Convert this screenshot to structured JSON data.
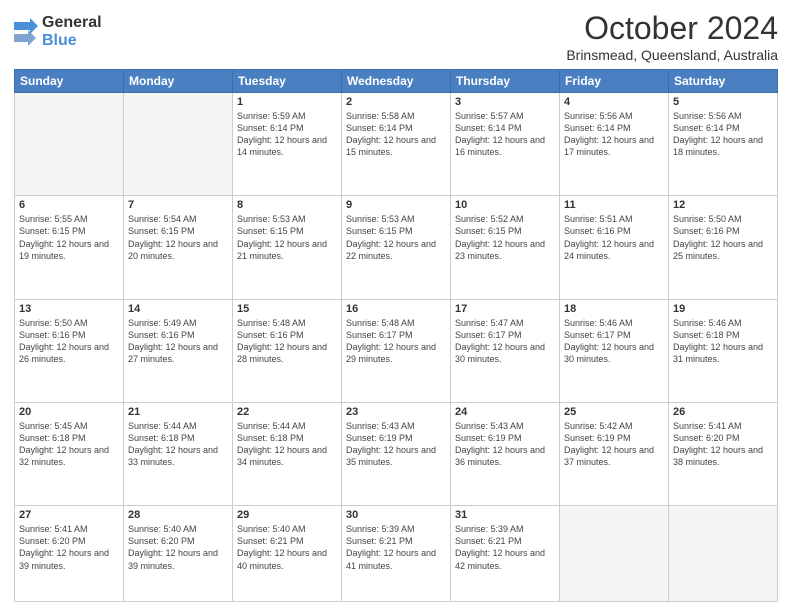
{
  "logo": {
    "general": "General",
    "blue": "Blue"
  },
  "header": {
    "month": "October 2024",
    "location": "Brinsmead, Queensland, Australia"
  },
  "weekdays": [
    "Sunday",
    "Monday",
    "Tuesday",
    "Wednesday",
    "Thursday",
    "Friday",
    "Saturday"
  ],
  "weeks": [
    [
      {
        "day": "",
        "info": ""
      },
      {
        "day": "",
        "info": ""
      },
      {
        "day": "1",
        "info": "Sunrise: 5:59 AM\nSunset: 6:14 PM\nDaylight: 12 hours and 14 minutes."
      },
      {
        "day": "2",
        "info": "Sunrise: 5:58 AM\nSunset: 6:14 PM\nDaylight: 12 hours and 15 minutes."
      },
      {
        "day": "3",
        "info": "Sunrise: 5:57 AM\nSunset: 6:14 PM\nDaylight: 12 hours and 16 minutes."
      },
      {
        "day": "4",
        "info": "Sunrise: 5:56 AM\nSunset: 6:14 PM\nDaylight: 12 hours and 17 minutes."
      },
      {
        "day": "5",
        "info": "Sunrise: 5:56 AM\nSunset: 6:14 PM\nDaylight: 12 hours and 18 minutes."
      }
    ],
    [
      {
        "day": "6",
        "info": "Sunrise: 5:55 AM\nSunset: 6:15 PM\nDaylight: 12 hours and 19 minutes."
      },
      {
        "day": "7",
        "info": "Sunrise: 5:54 AM\nSunset: 6:15 PM\nDaylight: 12 hours and 20 minutes."
      },
      {
        "day": "8",
        "info": "Sunrise: 5:53 AM\nSunset: 6:15 PM\nDaylight: 12 hours and 21 minutes."
      },
      {
        "day": "9",
        "info": "Sunrise: 5:53 AM\nSunset: 6:15 PM\nDaylight: 12 hours and 22 minutes."
      },
      {
        "day": "10",
        "info": "Sunrise: 5:52 AM\nSunset: 6:15 PM\nDaylight: 12 hours and 23 minutes."
      },
      {
        "day": "11",
        "info": "Sunrise: 5:51 AM\nSunset: 6:16 PM\nDaylight: 12 hours and 24 minutes."
      },
      {
        "day": "12",
        "info": "Sunrise: 5:50 AM\nSunset: 6:16 PM\nDaylight: 12 hours and 25 minutes."
      }
    ],
    [
      {
        "day": "13",
        "info": "Sunrise: 5:50 AM\nSunset: 6:16 PM\nDaylight: 12 hours and 26 minutes."
      },
      {
        "day": "14",
        "info": "Sunrise: 5:49 AM\nSunset: 6:16 PM\nDaylight: 12 hours and 27 minutes."
      },
      {
        "day": "15",
        "info": "Sunrise: 5:48 AM\nSunset: 6:16 PM\nDaylight: 12 hours and 28 minutes."
      },
      {
        "day": "16",
        "info": "Sunrise: 5:48 AM\nSunset: 6:17 PM\nDaylight: 12 hours and 29 minutes."
      },
      {
        "day": "17",
        "info": "Sunrise: 5:47 AM\nSunset: 6:17 PM\nDaylight: 12 hours and 30 minutes."
      },
      {
        "day": "18",
        "info": "Sunrise: 5:46 AM\nSunset: 6:17 PM\nDaylight: 12 hours and 30 minutes."
      },
      {
        "day": "19",
        "info": "Sunrise: 5:46 AM\nSunset: 6:18 PM\nDaylight: 12 hours and 31 minutes."
      }
    ],
    [
      {
        "day": "20",
        "info": "Sunrise: 5:45 AM\nSunset: 6:18 PM\nDaylight: 12 hours and 32 minutes."
      },
      {
        "day": "21",
        "info": "Sunrise: 5:44 AM\nSunset: 6:18 PM\nDaylight: 12 hours and 33 minutes."
      },
      {
        "day": "22",
        "info": "Sunrise: 5:44 AM\nSunset: 6:18 PM\nDaylight: 12 hours and 34 minutes."
      },
      {
        "day": "23",
        "info": "Sunrise: 5:43 AM\nSunset: 6:19 PM\nDaylight: 12 hours and 35 minutes."
      },
      {
        "day": "24",
        "info": "Sunrise: 5:43 AM\nSunset: 6:19 PM\nDaylight: 12 hours and 36 minutes."
      },
      {
        "day": "25",
        "info": "Sunrise: 5:42 AM\nSunset: 6:19 PM\nDaylight: 12 hours and 37 minutes."
      },
      {
        "day": "26",
        "info": "Sunrise: 5:41 AM\nSunset: 6:20 PM\nDaylight: 12 hours and 38 minutes."
      }
    ],
    [
      {
        "day": "27",
        "info": "Sunrise: 5:41 AM\nSunset: 6:20 PM\nDaylight: 12 hours and 39 minutes."
      },
      {
        "day": "28",
        "info": "Sunrise: 5:40 AM\nSunset: 6:20 PM\nDaylight: 12 hours and 39 minutes."
      },
      {
        "day": "29",
        "info": "Sunrise: 5:40 AM\nSunset: 6:21 PM\nDaylight: 12 hours and 40 minutes."
      },
      {
        "day": "30",
        "info": "Sunrise: 5:39 AM\nSunset: 6:21 PM\nDaylight: 12 hours and 41 minutes."
      },
      {
        "day": "31",
        "info": "Sunrise: 5:39 AM\nSunset: 6:21 PM\nDaylight: 12 hours and 42 minutes."
      },
      {
        "day": "",
        "info": ""
      },
      {
        "day": "",
        "info": ""
      }
    ]
  ]
}
